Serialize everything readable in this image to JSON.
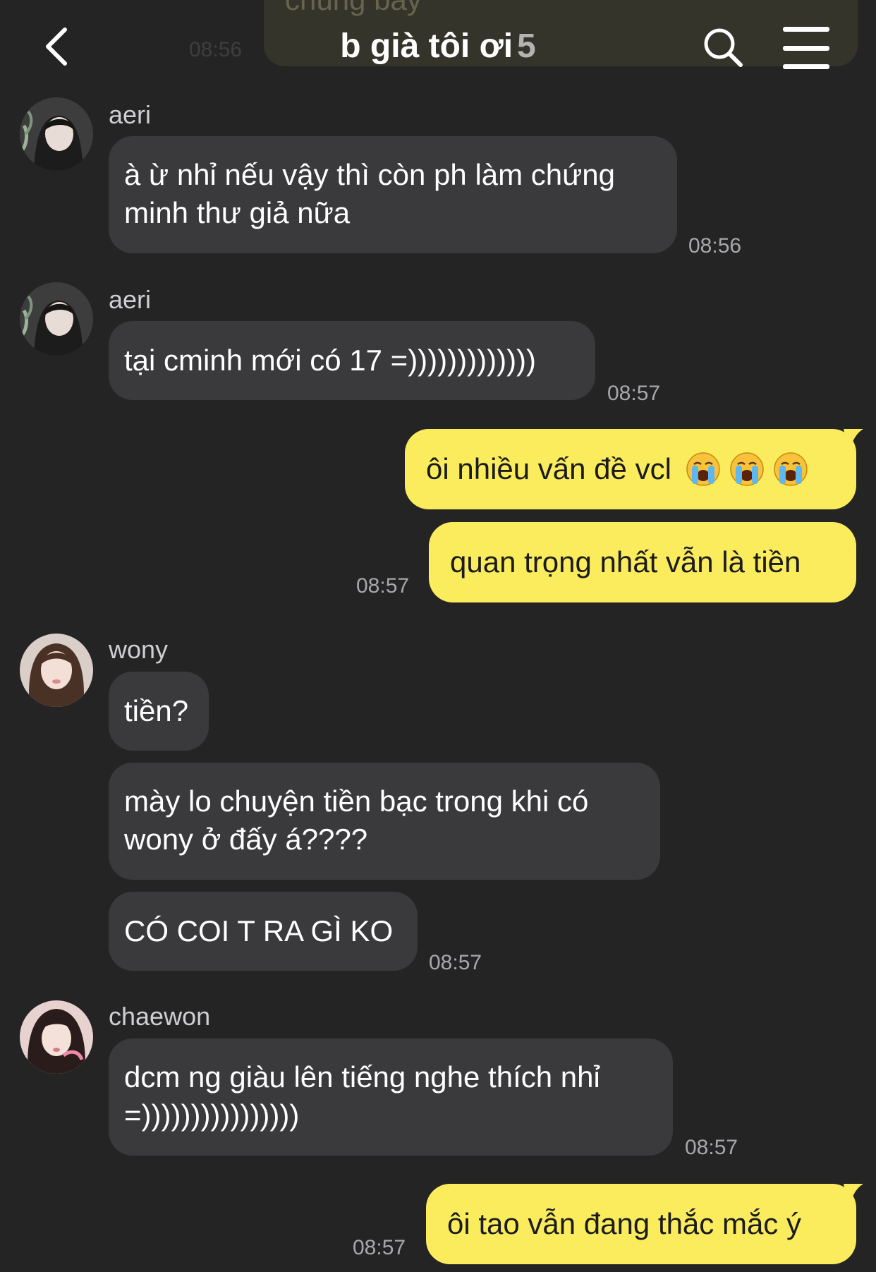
{
  "header": {
    "title": "b già tôi ơi",
    "member_count": "5",
    "prev_message_partial": "chúng bây",
    "prev_time": "08:56"
  },
  "colors": {
    "background": "#242425",
    "bubble_incoming": "#3a3a3d",
    "bubble_outgoing": "#fbec5d"
  },
  "icons": [
    "chevron-left-icon",
    "search-icon",
    "menu-icon",
    "loudly-crying-face-emoji"
  ],
  "messages": {
    "m1": {
      "sender": "aeri",
      "lines": [
        "à ừ nhỉ nếu vậy thì còn ph làm chứng",
        "minh thư giả nữa"
      ],
      "time": "08:56"
    },
    "m2": {
      "sender": "aeri",
      "text": "tại cminh mới có 17 =)))))))))))))",
      "time": "08:57"
    },
    "m3": {
      "text": "ôi nhiều vấn đề vcl",
      "emoji": "😭😭😭"
    },
    "m4": {
      "text": "quan trọng nhất vẫn là tiền",
      "time": "08:57"
    },
    "m5": {
      "sender": "wony",
      "text": "tiền?"
    },
    "m6": {
      "lines": [
        "mày lo chuyện tiền bạc trong khi có",
        "wony ở đấy á????"
      ]
    },
    "m7": {
      "text": "CÓ COI T RA GÌ KO",
      "time": "08:57"
    },
    "m8": {
      "sender": "chaewon",
      "lines": [
        "dcm ng giàu lên tiếng nghe thích nhỉ",
        "=))))))))))))))))"
      ],
      "time": "08:57"
    },
    "m9": {
      "text": "ôi tao vẫn đang thắc mắc ý",
      "time": "08:57"
    }
  }
}
